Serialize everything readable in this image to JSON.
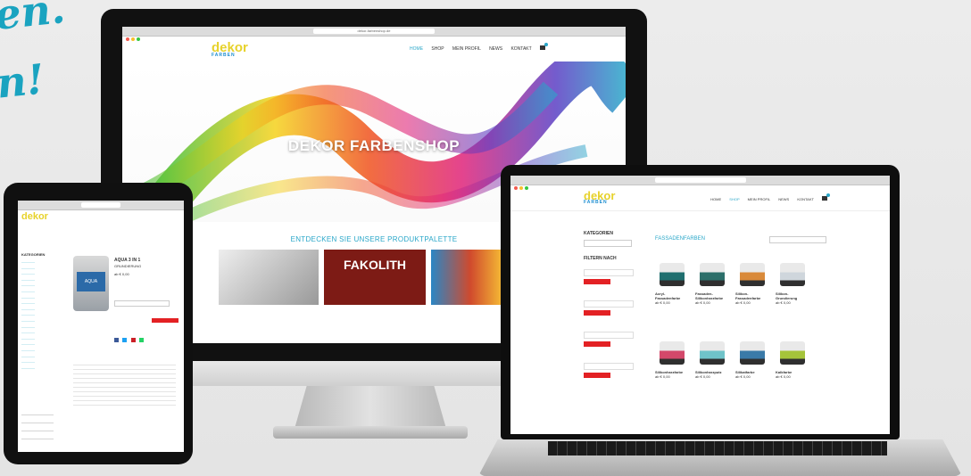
{
  "decor": {
    "script_line1": "en.",
    "script_line2": "n!"
  },
  "imac": {
    "url": "dekor-farbenshop.de",
    "logo_text": "dekor",
    "logo_sub": "FARBEN",
    "nav": [
      "HOME",
      "SHOP",
      "MEIN PROFIL",
      "NEWS",
      "KONTAKT"
    ],
    "hero_title": "DEKOR FARBENSHOP",
    "section_title": "ENTDECKEN SIE UNSERE PRODUKTPALETTE",
    "tile2_label": "FAKOLITH"
  },
  "laptop": {
    "categories_label": "KATEGORIEN",
    "filter_label": "FILTERN NACH",
    "page_title": "FASSADENFARBEN",
    "products": [
      {
        "name": "Acryl-Fassadenfarbe",
        "price": "ab € 0,00",
        "color": "#1f6f6f"
      },
      {
        "name": "Fassaden-Silikonharzfarbe",
        "price": "ab € 0,00",
        "color": "#2c6f6a"
      },
      {
        "name": "Silikon-Fassadenfarbe",
        "price": "ab € 0,00",
        "color": "#d98a3a"
      },
      {
        "name": "Silikon-Grundierung",
        "price": "ab € 0,00",
        "color": "#cfd6dc"
      },
      {
        "name": "Silikonharzfarbe",
        "price": "ab € 0,00",
        "color": "#d3486a"
      },
      {
        "name": "Silikonharzputz",
        "price": "ab € 0,00",
        "color": "#6fc3c9"
      },
      {
        "name": "Silikatfarbe",
        "price": "ab € 0,00",
        "color": "#3a7aa8"
      },
      {
        "name": "Kalkfarbe",
        "price": "ab € 0,00",
        "color": "#a5c43a"
      }
    ]
  },
  "tablet": {
    "logo_text": "dekor",
    "categories_label": "KATEGORIEN",
    "product_title": "AQUA 3 IN 1",
    "product_sub": "GRUNDIERUNG",
    "price": "ab € 0,00"
  }
}
